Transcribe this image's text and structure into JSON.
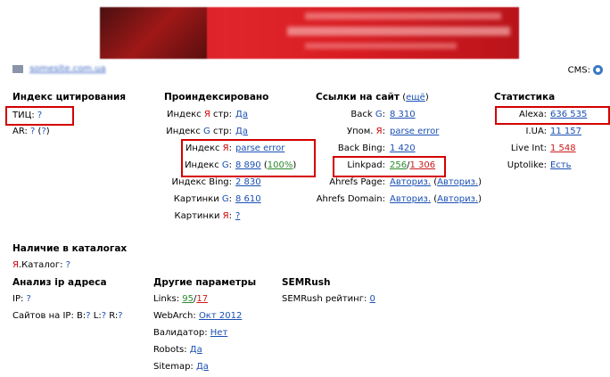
{
  "site": {
    "domain_blurred": "somesite.com.ua",
    "cms_label": "CMS:"
  },
  "citation": {
    "heading": "Индекс цитирования",
    "tic_label": "ТИЦ:",
    "tic_value": "?",
    "ar_label": "AR:",
    "ar_value": "?",
    "ar_paren_open": "(",
    "ar_paren_value": "?",
    "ar_paren_close": ")"
  },
  "indexed": {
    "heading": "Проиндексировано",
    "rows": [
      {
        "pre": "Индекс ",
        "engine": "Я",
        "post": " стр:",
        "value": "Да"
      },
      {
        "pre": "Индекс ",
        "engine": "G",
        "post": " стр:",
        "value": "Да"
      },
      {
        "pre": "Индекс ",
        "engine": "Я",
        "post": ":",
        "value": "parse error"
      },
      {
        "pre": "Индекс ",
        "engine": "G",
        "post": ":",
        "value": "8 890",
        "extra": "100%"
      },
      {
        "pre": "Индекс Bing:",
        "engine": "",
        "post": "",
        "value": "2 830"
      },
      {
        "pre": "Картинки ",
        "engine": "G",
        "post": ":",
        "value": "8 610"
      },
      {
        "pre": "Картинки ",
        "engine": "Я",
        "post": ":",
        "value": "?"
      }
    ]
  },
  "links": {
    "heading": "Ссылки на сайт",
    "more": "ещё",
    "rows": [
      {
        "pre": "Back ",
        "engine": "G",
        "post": ":",
        "value": "8 310"
      },
      {
        "pre": "Упом. ",
        "engine": "Я",
        "post": ":",
        "value": "parse error"
      },
      {
        "pre": "Back Bing:",
        "engine": "",
        "post": "",
        "value": "1 420"
      },
      {
        "pre": "Linkpad:",
        "engine": "",
        "post": "",
        "v1": "256",
        "v2": "1 306"
      },
      {
        "pre": "Ahrefs Page:",
        "engine": "",
        "post": "",
        "value": "Авториз.",
        "extra": "Авториз."
      },
      {
        "pre": "Ahrefs Domain:",
        "engine": "",
        "post": "",
        "value": "Авториз.",
        "extra": "Авториз."
      }
    ]
  },
  "stats": {
    "heading": "Статистика",
    "rows": [
      {
        "label": "Alexa:",
        "value": "636 535"
      },
      {
        "label": "I.UA:",
        "value": "11 157"
      },
      {
        "label": "Live Int:",
        "value": "1 548"
      },
      {
        "label": "Uptolike:",
        "value": "Есть"
      }
    ]
  },
  "catalogs": {
    "heading": "Наличие в каталогах",
    "ya": "Я",
    "label": ".Каталог:",
    "value": "?"
  },
  "ip": {
    "heading": "Анализ ip адреса",
    "ip_label": "IP:",
    "ip_value": "?",
    "sites_label": "Сайтов на IP:",
    "b": "B:",
    "l": "L:",
    "r": "R:",
    "q": "?"
  },
  "other": {
    "heading": "Другие параметры",
    "links_label": "Links:",
    "links_in": "95",
    "links_out": "17",
    "webarch_label": "WebArch:",
    "webarch_value": "Окт 2012",
    "validator_label": "Валидатор:",
    "validator_value": "Нет",
    "robots_label": "Robots:",
    "robots_value": "Да",
    "sitemap_label": "Sitemap:",
    "sitemap_value": "Да"
  },
  "semrush": {
    "heading": "SEMRush",
    "label": "SEMRush рейтинг:",
    "value": "0"
  },
  "colors": {
    "highlight_box": "#d40000",
    "link": "#1a4fb3",
    "green": "#2b8a2b",
    "red": "#cc1a1a"
  }
}
